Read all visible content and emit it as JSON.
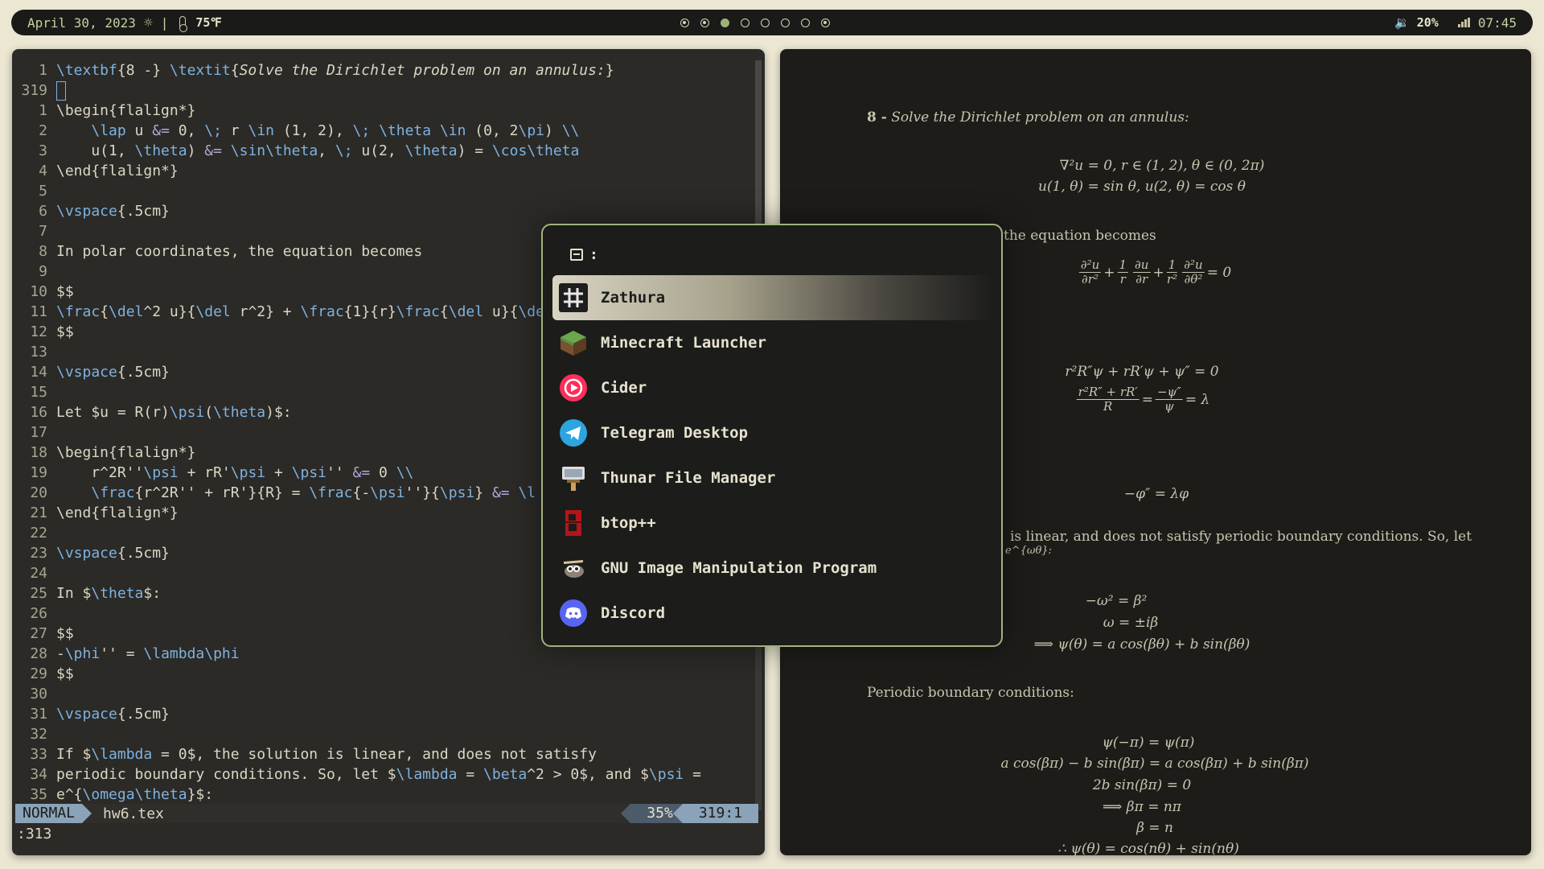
{
  "topbar": {
    "date": "April 30, 2023",
    "separator": "|",
    "temperature": "75℉",
    "workspaces": [
      {
        "state": "occupied"
      },
      {
        "state": "occupied"
      },
      {
        "state": "active"
      },
      {
        "state": "empty"
      },
      {
        "state": "empty"
      },
      {
        "state": "empty"
      },
      {
        "state": "empty"
      },
      {
        "state": "occupied"
      }
    ],
    "volume": "🔉 20%",
    "time": "07:45"
  },
  "editor": {
    "lines": [
      {
        "n": "1",
        "html": "<span class='k'>\\textbf</span>{8 -} <span class='k'>\\textit</span>{<span class='it'>Solve the Dirichlet problem on an annulus:</span>}"
      },
      {
        "n": "319",
        "html": "<span class='cursor-box'></span>"
      },
      {
        "n": "1",
        "html": "\\begin{flalign*}"
      },
      {
        "n": "2",
        "html": "    <span class='k'>\\lap</span> u <span class='p'>&amp;=</span> 0, <span class='k'>\\;</span> r <span class='k'>\\in</span> (1, 2), <span class='k'>\\;</span> <span class='k'>\\theta</span> <span class='k'>\\in</span> (0, 2<span class='k'>\\pi</span>) <span class='k'>\\\\</span>"
      },
      {
        "n": "3",
        "html": "    u(1, <span class='k'>\\theta</span>) <span class='p'>&amp;=</span> <span class='k'>\\sin\\theta</span>, <span class='k'>\\;</span> u(2, <span class='k'>\\theta</span>) = <span class='k'>\\cos\\theta</span>"
      },
      {
        "n": "4",
        "html": "\\end{flalign*}"
      },
      {
        "n": "5",
        "html": ""
      },
      {
        "n": "6",
        "html": "<span class='k'>\\vspace</span>{.5cm}"
      },
      {
        "n": "7",
        "html": ""
      },
      {
        "n": "8",
        "html": "In polar coordinates, the equation becomes"
      },
      {
        "n": "9",
        "html": ""
      },
      {
        "n": "10",
        "html": "$$"
      },
      {
        "n": "11",
        "html": "<span class='k'>\\frac</span>{<span class='k'>\\del</span>^2 u}{<span class='k'>\\del</span> r^2} + <span class='k'>\\frac</span>{1}{r}<span class='k'>\\frac</span>{<span class='k'>\\del</span> u}{<span class='k'>\\del</span>"
      },
      {
        "n": "12",
        "html": "$$"
      },
      {
        "n": "13",
        "html": ""
      },
      {
        "n": "14",
        "html": "<span class='k'>\\vspace</span>{.5cm}"
      },
      {
        "n": "15",
        "html": ""
      },
      {
        "n": "16",
        "html": "Let $u = R(r)<span class='k'>\\psi</span>(<span class='k'>\\theta</span>)$:"
      },
      {
        "n": "17",
        "html": ""
      },
      {
        "n": "18",
        "html": "\\begin{flalign*}"
      },
      {
        "n": "19",
        "html": "    r^2R''<span class='k'>\\psi</span> + rR'<span class='k'>\\psi</span> + <span class='k'>\\psi</span>'' <span class='p'>&amp;=</span> 0 <span class='k'>\\\\</span>"
      },
      {
        "n": "20",
        "html": "    <span class='k'>\\frac</span>{r^2R'' + rR'}{R} = <span class='k'>\\frac</span>{-<span class='k'>\\psi</span>''}{<span class='k'>\\psi</span>} <span class='p'>&amp;=</span> <span class='k'>\\l</span>"
      },
      {
        "n": "21",
        "html": "\\end{flalign*}"
      },
      {
        "n": "22",
        "html": ""
      },
      {
        "n": "23",
        "html": "<span class='k'>\\vspace</span>{.5cm}"
      },
      {
        "n": "24",
        "html": ""
      },
      {
        "n": "25",
        "html": "In $<span class='k'>\\theta</span>$:"
      },
      {
        "n": "26",
        "html": ""
      },
      {
        "n": "27",
        "html": "$$"
      },
      {
        "n": "28",
        "html": "-<span class='k'>\\phi</span>'' = <span class='k'>\\lambda\\phi</span>"
      },
      {
        "n": "29",
        "html": "$$"
      },
      {
        "n": "30",
        "html": ""
      },
      {
        "n": "31",
        "html": "<span class='k'>\\vspace</span>{.5cm}"
      },
      {
        "n": "32",
        "html": ""
      },
      {
        "n": "33",
        "html": "If $<span class='k'>\\lambda</span> = 0$, the solution is linear, and does not satisfy"
      },
      {
        "n": "34",
        "html": "periodic boundary conditions. So, let $<span class='k'>\\lambda</span> = <span class='k'>\\beta</span>^2 &gt; 0$, and $<span class='k'>\\psi</span> ="
      },
      {
        "n": "35",
        "html": "e^{<span class='k'>\\omega\\theta</span>}$:"
      }
    ],
    "status": {
      "mode": "NORMAL",
      "file": "hw6.tex",
      "percent": "35%",
      "position": "319:1"
    },
    "command": ":313"
  },
  "pdf": {
    "heading_bold": "8 -",
    "heading_italic": "Solve the Dirichlet problem on an annulus:",
    "eq1": "∇²u = 0,  r ∈ (1, 2),  θ ∈ (0, 2π)",
    "eq2": "u(1, θ) = sin θ,  u(2, θ) = cos θ",
    "text_polar": "the equation becomes",
    "pde_num1": "∂²u",
    "pde_den1": "∂r²",
    "pde_num2": "1",
    "pde_den2": "r",
    "pde_num3": "∂u",
    "pde_den3": "∂r",
    "pde_num4": "1",
    "pde_den4": "r²",
    "pde_num5": "∂²u",
    "pde_den5": "∂θ²",
    "pde_tail": "= 0",
    "sep1": "r²R″ψ + rR′ψ + ψ″ = 0",
    "sep2_num": "r²R″ + rR′",
    "sep2_den": "R",
    "sep2_num2": "−ψ″",
    "sep2_den2": "ψ",
    "sep2_tail": "= λ",
    "phi_eq": "−φ″ = λφ",
    "linear_text": "is linear, and does not satisfy periodic boundary conditions. So, let",
    "e_fragment": "e^{ωθ}:",
    "om1": "−ω² = β²",
    "om2": "ω = ±iβ",
    "om3": "⟹  ψ(θ) = a cos(βθ) + b sin(βθ)",
    "pbc": "Periodic boundary conditions:",
    "b1": "ψ(−π) = ψ(π)",
    "b2": "a cos(βπ) − b sin(βπ) = a cos(βπ) + b sin(βπ)",
    "b3": "2b sin(βπ) = 0",
    "b4": "⟹  βπ = nπ",
    "b5": "β = n",
    "b6": "∴ ψ(θ) = cos(nθ) + sin(nθ)"
  },
  "launcher": {
    "prompt": ":",
    "items": [
      {
        "label": "Zathura",
        "icon": "zathura-icon",
        "selected": true
      },
      {
        "label": "Minecraft Launcher",
        "icon": "minecraft-icon"
      },
      {
        "label": "Cider",
        "icon": "cider-icon"
      },
      {
        "label": "Telegram Desktop",
        "icon": "telegram-icon"
      },
      {
        "label": "Thunar File Manager",
        "icon": "thunar-icon"
      },
      {
        "label": "btop++",
        "icon": "btop-icon"
      },
      {
        "label": "GNU Image Manipulation Program",
        "icon": "gimp-icon"
      },
      {
        "label": "Discord",
        "icon": "discord-icon"
      }
    ]
  },
  "colors": {
    "accent": "#9fb27e",
    "keyword": "#7fb2e0",
    "operator": "#b3a6d8",
    "bar_bg": "#1a1a18"
  }
}
